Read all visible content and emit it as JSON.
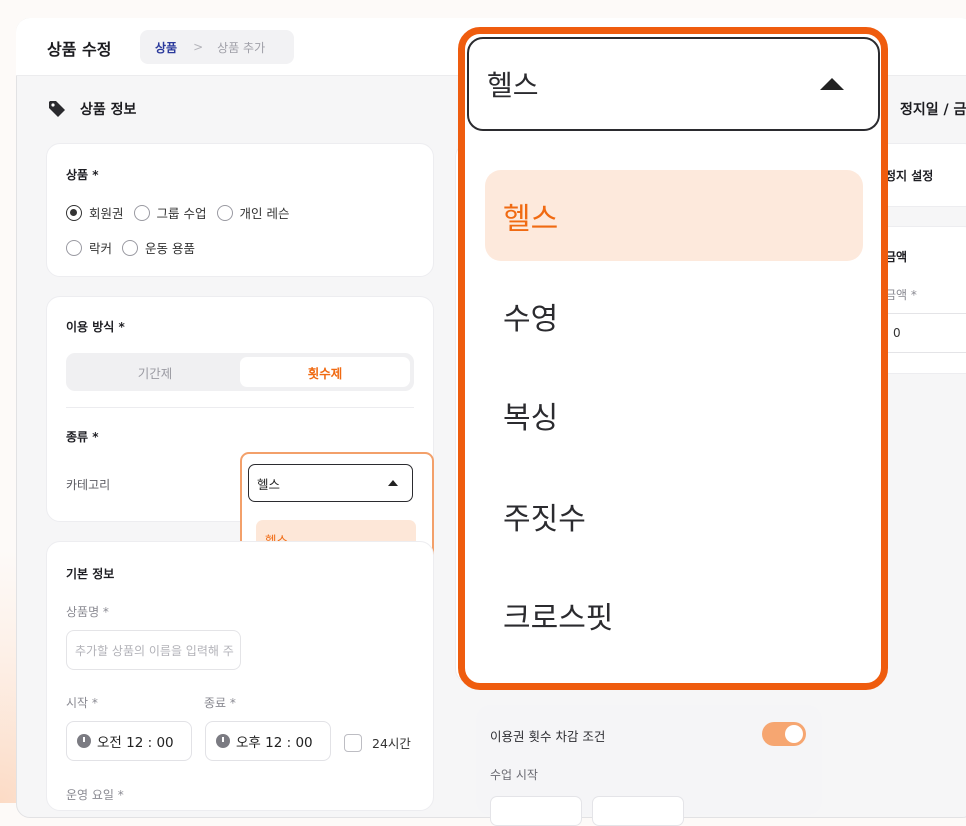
{
  "header": {
    "title": "상품 수정",
    "breadcrumb_current": "상품",
    "breadcrumb_sep": ">",
    "breadcrumb_next": "상품 추가"
  },
  "left": {
    "section_title": "상품 정보",
    "product_label": "상품 *",
    "product_options": [
      "회원권",
      "그룹 수업",
      "개인 레슨",
      "락커",
      "운동 용품"
    ],
    "product_selected": "회원권",
    "usage_label": "이용 방식 *",
    "usage_tabs": [
      "기간제",
      "횟수제"
    ],
    "usage_selected": "횟수제",
    "kind_label": "종류 *",
    "category_label": "카테고리",
    "category_value": "헬스",
    "basic_title": "기본 정보",
    "name_label": "상품명 *",
    "name_placeholder": "추가할 상품의 이름을 입력해 주",
    "start_label": "시작 *",
    "end_label": "종료 *",
    "start_time": "오전  12 : 00",
    "end_time": "오후  12 : 00",
    "allday_label": "24시간",
    "weekday_label": "운영 요일 *"
  },
  "dropdown": {
    "selected": "헬스",
    "options": [
      "헬스",
      "수영",
      "복싱",
      "주짓수",
      "크로스핏"
    ]
  },
  "middle": {
    "deduct_label": "이용권 횟수 차감 조건",
    "deduct_on": true,
    "class_start_label": "수업 시작"
  },
  "right": {
    "section_title": "정지일 / 금",
    "pause_label": "정지 설정",
    "amount_title": "금액",
    "amount_label": "금액 *",
    "amount_value": "0"
  },
  "colors": {
    "accent": "#ef5c0e",
    "accent_light": "#fdeadf",
    "selected_text": "#f06a12"
  }
}
